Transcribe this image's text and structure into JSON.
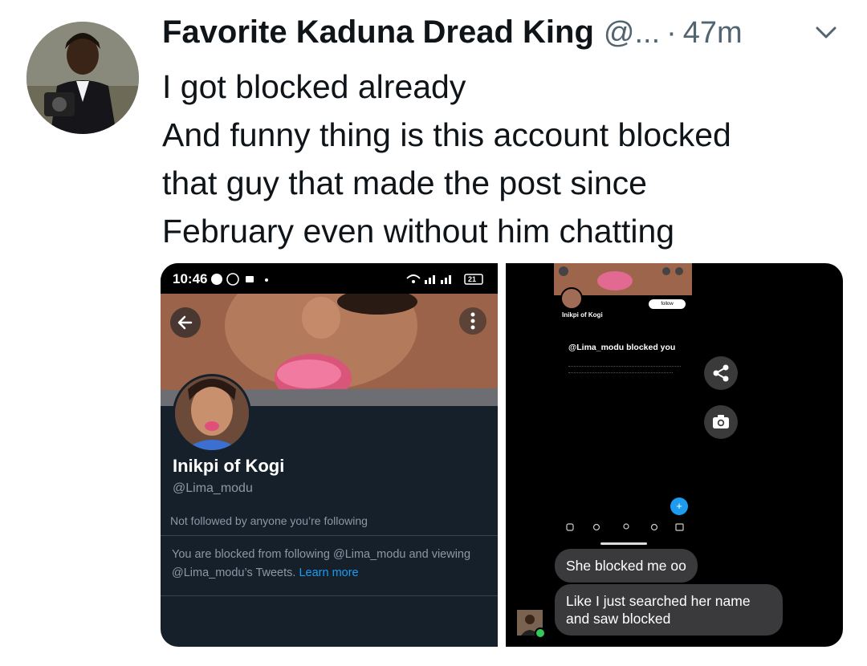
{
  "tweet": {
    "author_name": "Favorite Kaduna Dread King",
    "author_handle": "@...",
    "separator": "·",
    "time": "47m",
    "lines": [
      "I got blocked already",
      "And funny thing is this account blocked",
      "that guy that made the post since",
      "February even without him chatting"
    ]
  },
  "screenshot_left": {
    "status_time": "10:46",
    "battery": "21",
    "profile_name": "Inikpi of Kogi",
    "profile_handle": "@Lima_modu",
    "not_followed": "Not followed by anyone you’re following",
    "blocked_text": "You are blocked from following @Lima_modu and viewing @Lima_modu’s Tweets.",
    "learn_more": "Learn more"
  },
  "screenshot_right": {
    "mini_name": "Inikpi of Kogi",
    "mini_follow": "follow",
    "mini_blocked_title": "@Lima_modu blocked you",
    "fab_label": "+",
    "messages": [
      "She blocked me oo",
      "Like I just searched her name and saw blocked"
    ]
  },
  "colors": {
    "accent": "#1d9bf0",
    "text": "#0f1419",
    "secondary": "#536471",
    "dark_bg": "#15202b"
  }
}
